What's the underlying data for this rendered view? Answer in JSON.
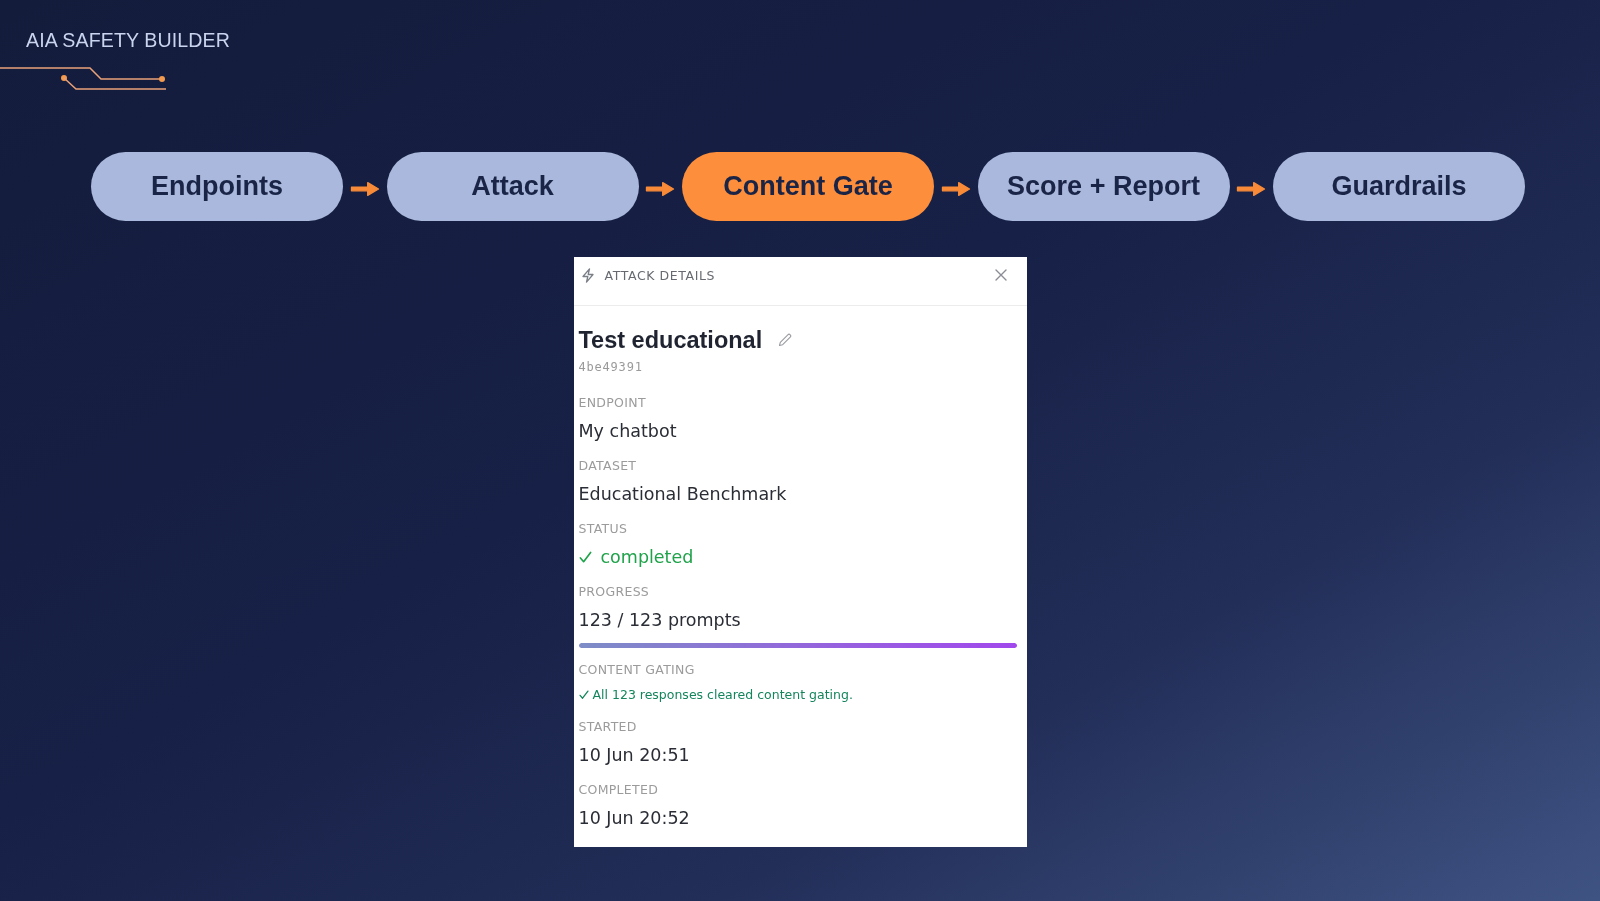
{
  "brand": {
    "title": "AIA SAFETY BUILDER"
  },
  "pipeline": {
    "steps": [
      {
        "label": "Endpoints",
        "selected": false
      },
      {
        "label": "Attack",
        "selected": false
      },
      {
        "label": "Content Gate",
        "selected": true
      },
      {
        "label": "Score + Report",
        "selected": false
      },
      {
        "label": "Guardrails",
        "selected": false
      }
    ]
  },
  "panel": {
    "title": "ATTACK DETAILS",
    "name": "Test educational",
    "short_id": "4be49391",
    "fields": [
      {
        "kind": "text",
        "label": "ENDPOINT",
        "value": "My chatbot"
      },
      {
        "kind": "text",
        "label": "DATASET",
        "value": "Educational Benchmark"
      },
      {
        "kind": "status",
        "label": "STATUS",
        "value": "completed"
      },
      {
        "kind": "progress",
        "label": "PROGRESS",
        "value": "123 / 123 prompts",
        "level": 1
      },
      {
        "kind": "note",
        "label": "CONTENT GATING",
        "value": "All 123 responses cleared content gating."
      },
      {
        "kind": "text",
        "label": "STARTED",
        "value": "10 Jun 20:51"
      },
      {
        "kind": "text",
        "label": "COMPLETED",
        "value": "10 Jun 20:52"
      }
    ]
  }
}
